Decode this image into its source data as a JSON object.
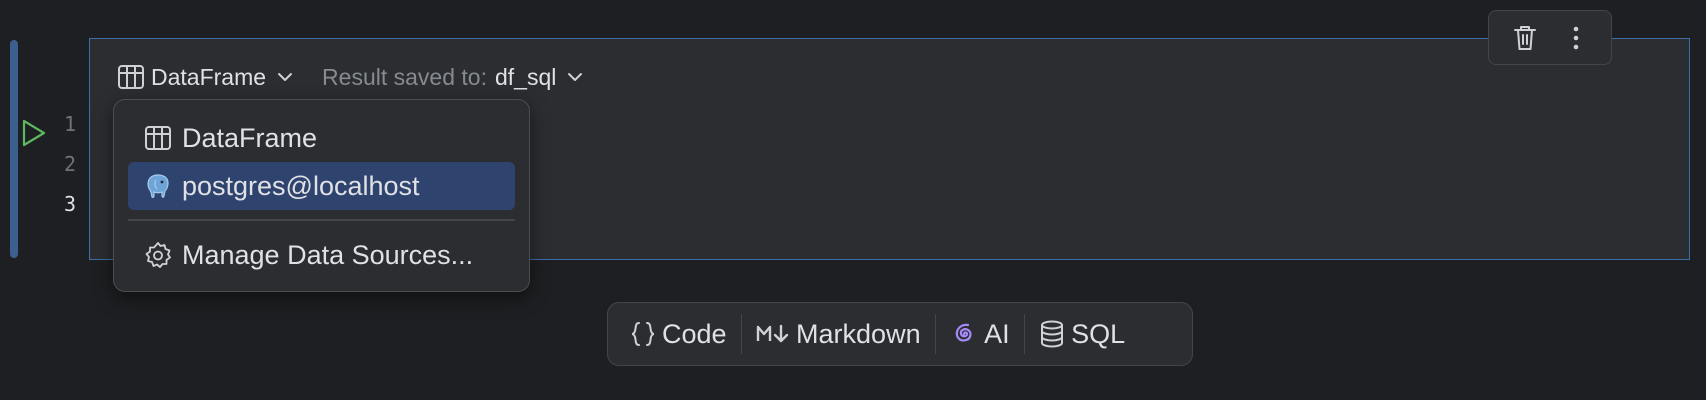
{
  "gutter": {
    "line_numbers": [
      "1",
      "2",
      "3"
    ]
  },
  "cell_header": {
    "output_type": "DataFrame",
    "result_saved_label": "Result saved to:",
    "result_variable": "df_sql"
  },
  "dropdown": {
    "items": [
      {
        "label": "DataFrame",
        "icon": "table-icon",
        "selected": false
      },
      {
        "label": "postgres@localhost",
        "icon": "postgres-elephant-icon",
        "selected": true
      },
      {
        "label": "Manage Data Sources...",
        "icon": "gear-icon",
        "selected": false
      }
    ]
  },
  "cell_toolbar": {
    "icons": [
      "trash-icon",
      "more-vertical-icon"
    ]
  },
  "add_cell_bar": {
    "code_label": "Code",
    "markdown_label": "Markdown",
    "ai_label": "AI",
    "sql_label": "SQL"
  },
  "colors": {
    "background": "#1e1f22",
    "cell_background": "#2b2d30",
    "cell_border_active": "#3c6ea8",
    "selection": "#2e436e",
    "run_green": "#5fb85f",
    "ai_purple": "#a78bfa"
  }
}
